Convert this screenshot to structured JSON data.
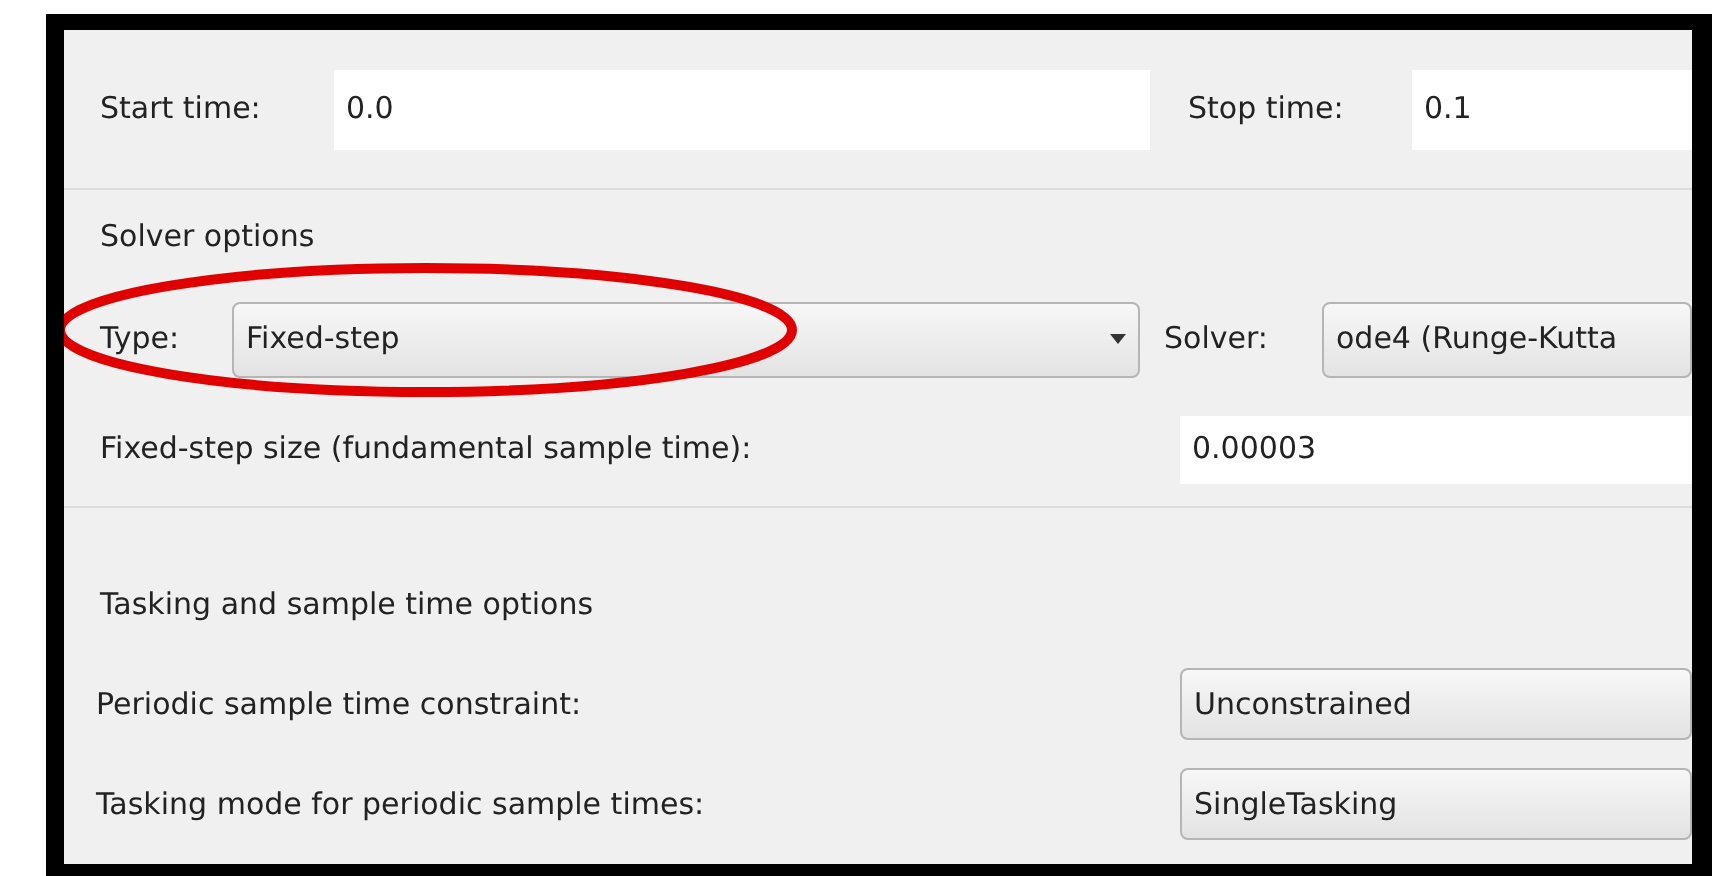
{
  "simulation_time": {
    "start_label": "Start time:",
    "start_value": "0.0",
    "stop_label": "Stop time:",
    "stop_value": "0.1"
  },
  "solver_options": {
    "heading": "Solver options",
    "type_label": "Type:",
    "type_value": "Fixed-step",
    "solver_label": "Solver:",
    "solver_value": "ode4 (Runge-Kutta",
    "step_label": "Fixed-step size (fundamental sample time):",
    "step_value": "0.00003"
  },
  "tasking_options": {
    "heading": "Tasking and sample time options",
    "rows": [
      {
        "label": "Periodic sample time constraint:",
        "value": "Unconstrained"
      },
      {
        "label": "Tasking mode for periodic sample times:",
        "value": "SingleTasking"
      }
    ]
  }
}
